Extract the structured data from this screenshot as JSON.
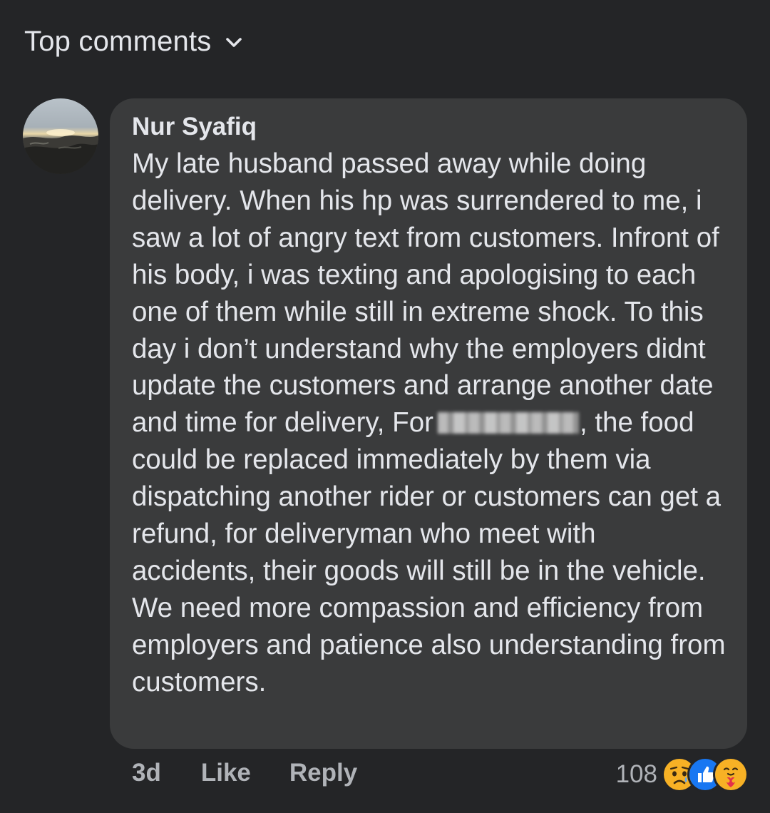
{
  "header": {
    "filter_label": "Top comments"
  },
  "comment": {
    "author": "Nur Syafiq",
    "body": {
      "part1": "My late husband passed away while doing delivery. When his hp was surrendered to me, i saw a lot of angry text from customers. Infront of his body, i was texting and apologising to each one of them while still in extreme shock. To this day i don’t understand why the employers didnt update the customers and arrange another date and time for delivery, For",
      "part2": ", the food could be replaced immediately by them via dispatching another rider or customers can get a refund, for deliveryman who meet with accidents, their goods will still be in the vehicle. We need more compassion and efficiency from employers and patience also understanding from customers."
    },
    "time": "3d",
    "like_label": "Like",
    "reply_label": "Reply",
    "reaction_count": "108",
    "reactions": [
      "sad-reaction-icon",
      "like-reaction-icon",
      "care-reaction-icon"
    ]
  },
  "colors": {
    "background": "#242527",
    "bubble": "#3a3b3c",
    "text_primary": "#e4e6eb",
    "text_secondary": "#b0b3b8",
    "like_blue": "#1877f2",
    "reaction_yellow": "#f7b125"
  }
}
